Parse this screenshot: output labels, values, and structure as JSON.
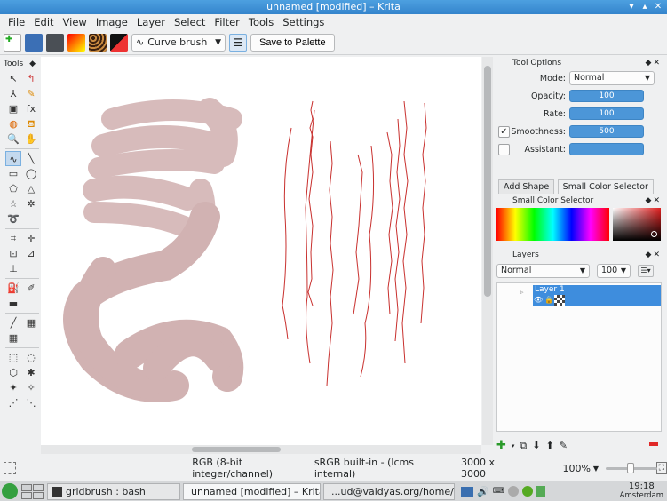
{
  "window": {
    "title": "unnamed [modified] – Krita"
  },
  "menu": [
    "File",
    "Edit",
    "View",
    "Image",
    "Layer",
    "Select",
    "Filter",
    "Tools",
    "Settings"
  ],
  "toolbar": {
    "brush_preset": "Curve brush",
    "save_to_palette": "Save to Palette"
  },
  "toolbox": {
    "title": "Tools"
  },
  "tool_options": {
    "title": "Tool Options",
    "mode_label": "Mode:",
    "mode_value": "Normal",
    "opacity_label": "Opacity:",
    "opacity_value": "100",
    "rate_label": "Rate:",
    "rate_value": "100",
    "smoothness_label": "Smoothness:",
    "smoothness_value": "500",
    "assistant_label": "Assistant:"
  },
  "tabs": {
    "add_shape": "Add Shape",
    "small_color_selector": "Small Color Selector"
  },
  "color_selector": {
    "title": "Small Color Selector"
  },
  "layers": {
    "title": "Layers",
    "blend_mode": "Normal",
    "opacity": "100",
    "items": [
      {
        "name": "Layer 1"
      }
    ]
  },
  "status": {
    "color_model": "RGB (8-bit integer/channel)",
    "profile": "sRGB built-in - (lcms internal)",
    "size": "3000 x 3000",
    "zoom": "100%"
  },
  "taskbar": {
    "tasks": [
      {
        "label": "gridbrush : bash"
      },
      {
        "label": "unnamed [modified] – Krita"
      },
      {
        "label": "...ud@valdyas.org/home/bo"
      }
    ],
    "time": "19:18",
    "location": "Amsterdam"
  },
  "colors": {
    "accent": "#3e8ddd",
    "stroke_red": "#c8302e",
    "stroke_brush": "#a05a5a"
  }
}
